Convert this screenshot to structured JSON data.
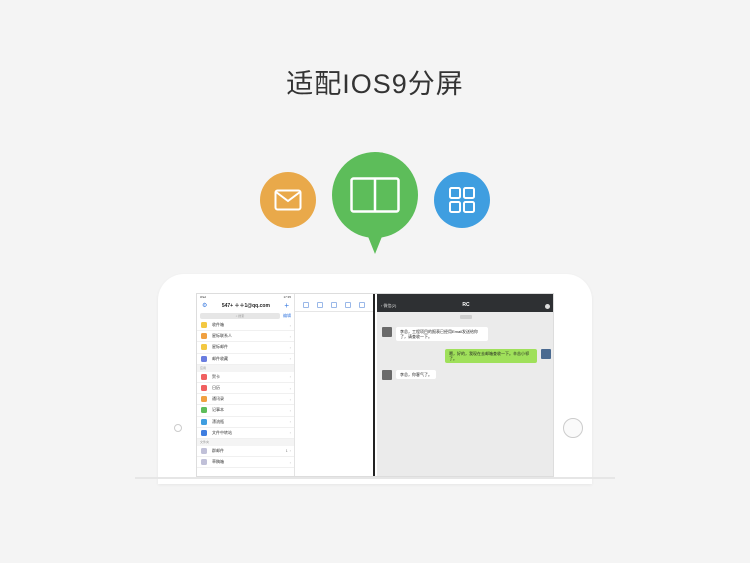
{
  "headline": "适配IOS9分屏",
  "colors": {
    "mail_circle": "#e9a94a",
    "split_circle": "#5dbd5a",
    "grid_circle": "#3f9ee0"
  },
  "icons": [
    "mail-icon",
    "split-screen-icon",
    "grid-apps-icon"
  ],
  "mail": {
    "status_left": "iPad",
    "status_time": "17:35",
    "account": "547+ ＋＋1@qq.com",
    "search_placeholder": "搜索",
    "edit_label": "编辑",
    "folders": [
      {
        "label": "收件箱",
        "color": "#f3c842"
      },
      {
        "label": "星标联系人",
        "color": "#f0a040"
      },
      {
        "label": "星标邮件",
        "color": "#f3c842"
      },
      {
        "label": "邮件收藏",
        "color": "#6a7de0"
      }
    ],
    "section_apps": "应用",
    "apps": [
      {
        "label": "贺卡",
        "color": "#f06060"
      },
      {
        "label": "日历",
        "color": "#f06060"
      },
      {
        "label": "通讯录",
        "color": "#f0a040"
      },
      {
        "label": "记事本",
        "color": "#5dbd5a"
      },
      {
        "label": "漂流瓶",
        "color": "#3f9ee0"
      },
      {
        "label": "文件中转站",
        "color": "#3f7ee0"
      }
    ],
    "section_folders": "文件夹",
    "other": [
      {
        "label": "群邮件",
        "count": "1",
        "color": "#c0c0d8"
      },
      {
        "label": "草稿箱",
        "count": "",
        "color": "#c0c0d8"
      }
    ]
  },
  "chat": {
    "back_label": "微信(2)",
    "title": "RC",
    "messages": [
      {
        "side": "left",
        "text": "李总，工程项目的报表已经用Email发送给你了，请查收一下。"
      },
      {
        "side": "right",
        "text": "嗯，好的，我现在去邮箱查收一下。辛苦小祁了。"
      },
      {
        "side": "left",
        "text": "李总，你客气了。"
      }
    ]
  }
}
